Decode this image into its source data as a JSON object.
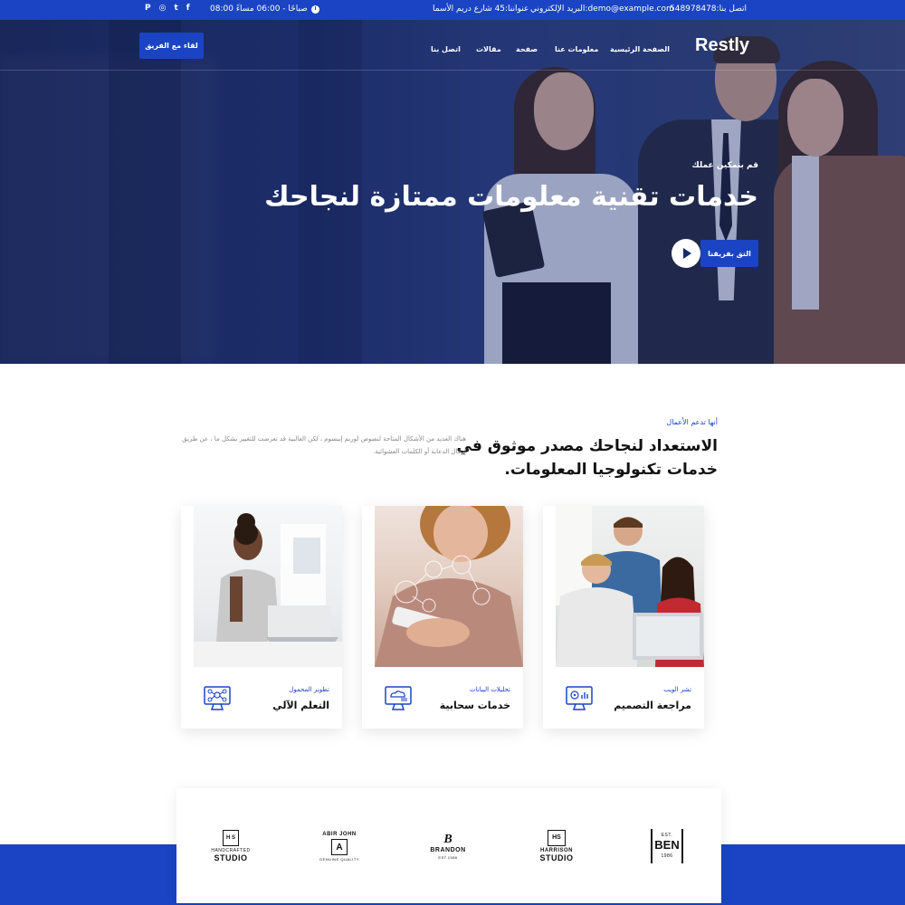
{
  "colors": {
    "accent": "#1a44c3",
    "hero_overlay": "#1c2d6e",
    "text_dark": "#111111",
    "text_muted": "#888888"
  },
  "topbar": {
    "socials": [
      {
        "icon": "pinterest-icon",
        "glyph": "P"
      },
      {
        "icon": "instagram-icon",
        "glyph": "◎"
      },
      {
        "icon": "twitter-icon",
        "glyph": "t"
      },
      {
        "icon": "facebook-icon",
        "glyph": "f"
      }
    ],
    "hours": "08:00 صباحًا - 06:00 مساءً",
    "address": "عنواننا:45 شارع دريم الأسما",
    "email": "البريد الإلكتروني:demo@example.com",
    "phone": "اتصل بنا:548978478"
  },
  "nav": {
    "logo": "Restly",
    "menu": [
      "الصفحة الرئيسية",
      "معلومات عنا",
      "صفحة",
      "مقالات",
      "اتصل بنا"
    ],
    "cta": "لقاء مع الفريق"
  },
  "hero": {
    "kicker": "قم بتمكين عملك",
    "title": "خدمات تقنية معلومات ممتازة لنجاحك",
    "explore": "التق بفريقنا",
    "play_icon": "play-icon"
  },
  "about": {
    "kicker": "أنها تدعم الأعمال",
    "title": "الاستعداد لنجاحك مصدر موثوق في خدمات تكنولوجيا المعلومات.",
    "text": "هناك العديد من الأشكال المتاحة لنصوص لوريم إيبسوم ، لكن الغالبية قد تعرضت للتغيير بشكل ما ، عن طريق إدخال الدعابة أو الكلمات العشوائية."
  },
  "cards": [
    {
      "category": "تطوير المحمول",
      "title": "التعلم الآلي",
      "icon": "machine-learning-icon"
    },
    {
      "category": "تحليلات البيانات",
      "title": "خدمات سحابية",
      "icon": "cloud-services-icon"
    },
    {
      "category": "تشر الويب",
      "title": "مراجعة التصميم",
      "icon": "design-review-icon"
    }
  ],
  "brands": [
    {
      "name": "handcrafted-studio",
      "mark": "H S",
      "line1": "HANDCRAFTED",
      "line2": "STUDIO"
    },
    {
      "name": "abir-john",
      "mark": "A",
      "line1": "ABIR JOHN",
      "line2": "GENUINE QUALITY"
    },
    {
      "name": "brandon",
      "mark": "B",
      "line1": "BRANDON",
      "line2": "EST.1986"
    },
    {
      "name": "harrison-studio",
      "mark": "HS",
      "line1": "HARRISON",
      "line2": "STUDIO"
    },
    {
      "name": "ben",
      "mark": "BEN",
      "line1": "EST.",
      "line2": "1986"
    }
  ]
}
